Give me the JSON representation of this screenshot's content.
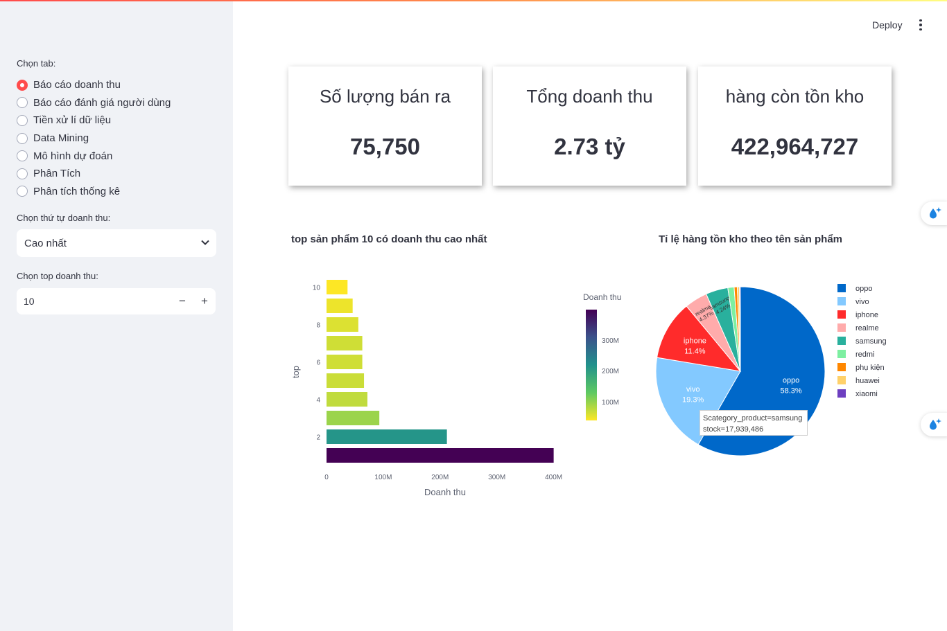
{
  "sidebar": {
    "tab_label": "Chọn tab:",
    "tabs": [
      {
        "label": "Báo cáo doanh thu",
        "selected": true
      },
      {
        "label": "Báo cáo đánh giá người dùng",
        "selected": false
      },
      {
        "label": "Tiền xử lí dữ liệu",
        "selected": false
      },
      {
        "label": "Data Mining",
        "selected": false
      },
      {
        "label": "Mô hình dự đoán",
        "selected": false
      },
      {
        "label": "Phân Tích",
        "selected": false
      },
      {
        "label": "Phân tích thống kê",
        "selected": false
      }
    ],
    "order_label": "Chọn thứ tự doanh thu:",
    "order_value": "Cao nhất",
    "top_label": "Chọn top doanh thu:",
    "top_value": "10",
    "minus": "−",
    "plus": "+"
  },
  "header": {
    "deploy": "Deploy"
  },
  "metrics": [
    {
      "title": "Số lượng bán ra",
      "value": "75,750"
    },
    {
      "title": "Tổng doanh thu",
      "value": "2.73 tỷ"
    },
    {
      "title": "hàng còn tồn kho",
      "value": "422,964,727"
    }
  ],
  "colors": {
    "accent": "#ff4b4b",
    "sidebar_bg": "#f0f2f6"
  },
  "chart_data": [
    {
      "type": "bar",
      "orientation": "horizontal",
      "title": "top sản phẩm 10 có doanh thu cao nhất",
      "xlabel": "Doanh thu",
      "ylabel": "top",
      "categories": [
        1,
        2,
        3,
        4,
        5,
        6,
        7,
        8,
        9,
        10
      ],
      "values": [
        400000000,
        212000000,
        93000000,
        72000000,
        66000000,
        63000000,
        63000000,
        56000000,
        46000000,
        37000000
      ],
      "xlim": [
        0,
        420000000
      ],
      "xticks": [
        "0",
        "100M",
        "200M",
        "300M",
        "400M"
      ],
      "yticks": [
        "2",
        "4",
        "6",
        "8",
        "10"
      ],
      "colorbar": {
        "title": "Doanh thu",
        "ticks": [
          "100M",
          "200M",
          "300M"
        ],
        "colorscale": "viridis"
      }
    },
    {
      "type": "pie",
      "title": "Tỉ lệ hàng tồn kho theo tên sản phẩm",
      "slices": [
        {
          "label": "oppo",
          "percent": 58.3,
          "color": "#0068c9"
        },
        {
          "label": "vivo",
          "percent": 19.3,
          "color": "#83c9ff"
        },
        {
          "label": "iphone",
          "percent": 11.4,
          "color": "#ff2b2b"
        },
        {
          "label": "realme",
          "percent": 4.37,
          "color": "#ffabab"
        },
        {
          "label": "samsung",
          "percent": 4.24,
          "color": "#29b09d"
        },
        {
          "label": "redmi",
          "percent": 1.2,
          "color": "#7defa1"
        },
        {
          "label": "phụ kiện",
          "percent": 0.6,
          "color": "#ff8700"
        },
        {
          "label": "huawei",
          "percent": 0.4,
          "color": "#ffd16a"
        },
        {
          "label": "xiaomi",
          "percent": 0.19,
          "color": "#6d3fc0"
        }
      ],
      "slice_labels": {
        "oppo": [
          "oppo",
          "58.3%"
        ],
        "vivo": [
          "vivo",
          "19.3%"
        ],
        "iphone": [
          "iphone",
          "11.4%"
        ],
        "realme": [
          "realme",
          "4.37%"
        ],
        "samsung": [
          "samsung",
          "4.24%"
        ]
      },
      "tooltip": {
        "line1": "Scategory_product=samsung",
        "line2": "stock=17,939,486"
      }
    }
  ]
}
